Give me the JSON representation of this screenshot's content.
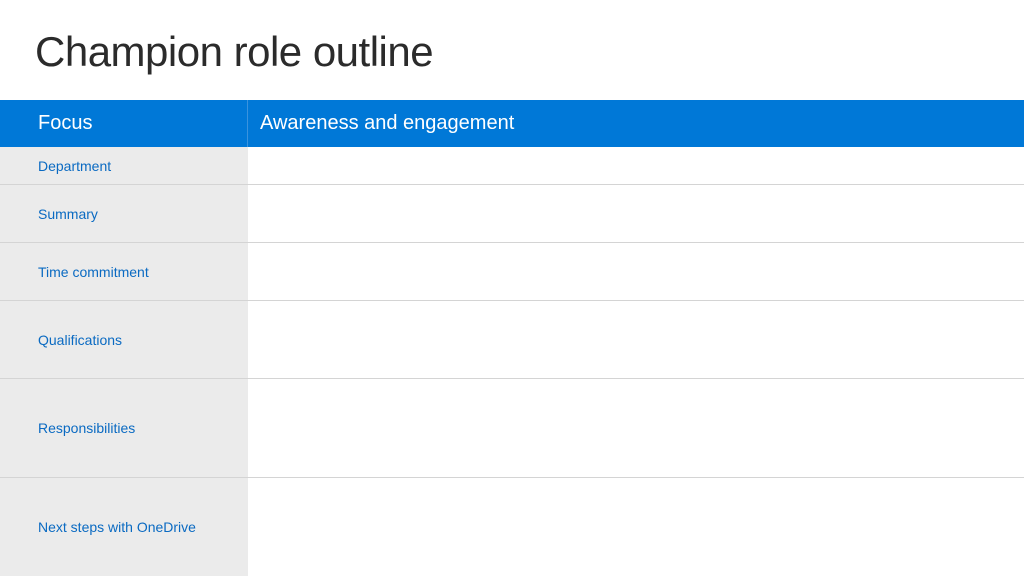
{
  "slide": {
    "title": "Champion role outline"
  },
  "table": {
    "header": {
      "left": "Focus",
      "right": "Awareness and engagement"
    },
    "rows": [
      {
        "label": "Department",
        "value": ""
      },
      {
        "label": "Summary",
        "value": ""
      },
      {
        "label": "Time commitment",
        "value": ""
      },
      {
        "label": "Qualifications",
        "value": ""
      },
      {
        "label": "Responsibilities",
        "value": ""
      },
      {
        "label": "Next steps with OneDrive",
        "value": ""
      }
    ]
  },
  "colors": {
    "header_blue": "#0078d7",
    "label_text_blue": "#0a6ac2",
    "label_bg_gray": "#ebebeb"
  }
}
